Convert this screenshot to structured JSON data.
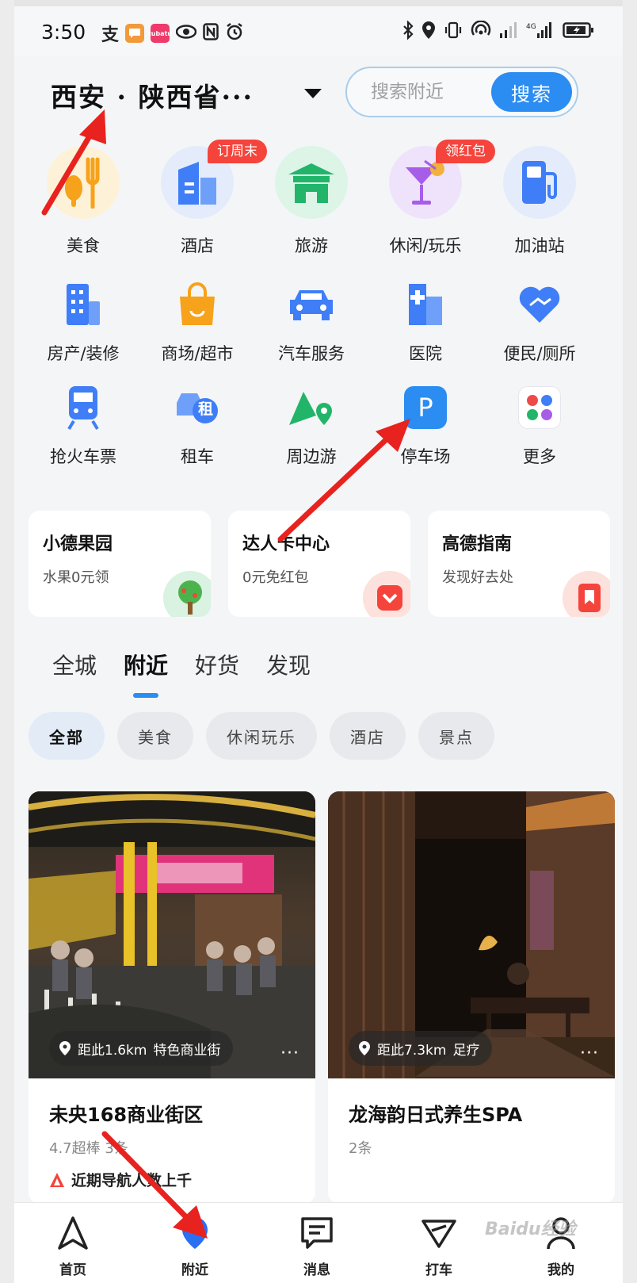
{
  "status_bar": {
    "time": "3:50",
    "left_icons": [
      "alipay-icon",
      "chat-bubble-icon",
      "app-badge-icon",
      "eye-icon",
      "nfc-icon",
      "alarm-icon"
    ],
    "app_badge_text": "tubatu",
    "right_icons": [
      "bluetooth-icon",
      "location-icon",
      "vibrate-icon",
      "hotspot-icon",
      "signal-icon",
      "4g-signal-icon",
      "battery-icon"
    ]
  },
  "header": {
    "city": "西安 · 陕西省···",
    "search_placeholder": "搜索附近",
    "search_button": "搜索"
  },
  "categories": [
    {
      "label": "美食",
      "icon": "food-icon",
      "color": "#f7a21b"
    },
    {
      "label": "酒店",
      "icon": "hotel-icon",
      "color": "#3f7ef6",
      "badge": "订周末"
    },
    {
      "label": "旅游",
      "icon": "travel-icon",
      "color": "#22b56a"
    },
    {
      "label": "休闲/玩乐",
      "icon": "cocktail-icon",
      "color": "#a65de8",
      "badge": "领红包"
    },
    {
      "label": "加油站",
      "icon": "gas-station-icon",
      "color": "#3f7ef6"
    },
    {
      "label": "房产/装修",
      "icon": "building-icon",
      "color": "#3f7ef6"
    },
    {
      "label": "商场/超市",
      "icon": "shopping-bag-icon",
      "color": "#f7a21b"
    },
    {
      "label": "汽车服务",
      "icon": "car-icon",
      "color": "#3f7ef6"
    },
    {
      "label": "医院",
      "icon": "hospital-icon",
      "color": "#3f7ef6"
    },
    {
      "label": "便民/厕所",
      "icon": "handshake-heart-icon",
      "color": "#3f7ef6"
    },
    {
      "label": "抢火车票",
      "icon": "train-icon",
      "color": "#3f7ef6"
    },
    {
      "label": "租车",
      "icon": "car-rental-icon",
      "color": "#3f7ef6",
      "icon_text": "租"
    },
    {
      "label": "周边游",
      "icon": "mountain-pin-icon",
      "color": "#22b56a"
    },
    {
      "label": "停车场",
      "icon": "parking-icon",
      "color": "#2b8cf2",
      "icon_text": "P"
    },
    {
      "label": "更多",
      "icon": "more-apps-icon",
      "color": "#ef4a4a"
    }
  ],
  "promos": [
    {
      "title": "小德果园",
      "subtitle": "水果0元领",
      "icon": "tree-icon"
    },
    {
      "title": "达人卡中心",
      "subtitle": "0元免红包",
      "icon": "red-envelope-icon"
    },
    {
      "title": "高德指南",
      "subtitle": "发现好去处",
      "icon": "bookmark-icon"
    }
  ],
  "tabs": [
    {
      "label": "全城",
      "active": false
    },
    {
      "label": "附近",
      "active": true
    },
    {
      "label": "好货",
      "active": false
    },
    {
      "label": "发现",
      "active": false
    }
  ],
  "chips": [
    {
      "label": "全部",
      "active": true
    },
    {
      "label": "美食",
      "active": false
    },
    {
      "label": "休闲玩乐",
      "active": false
    },
    {
      "label": "酒店",
      "active": false
    },
    {
      "label": "景点",
      "active": false
    }
  ],
  "feed": [
    {
      "distance": "距此1.6km",
      "category": "特色商业街",
      "title": "未央168商业街区",
      "subtitle": "4.7超棒 3条",
      "tag": "近期导航人数上千",
      "more": "···"
    },
    {
      "distance": "距此7.3km",
      "category": "足疗",
      "title": "龙海韵日式养生SPA",
      "subtitle": "2条",
      "more": "···"
    }
  ],
  "bottom_nav": [
    {
      "label": "首页",
      "icon": "navigation-arrow-icon"
    },
    {
      "label": "附近",
      "icon": "nearby-pin-icon"
    },
    {
      "label": "消息",
      "icon": "message-icon"
    },
    {
      "label": "打车",
      "icon": "taxi-icon"
    },
    {
      "label": "我的",
      "icon": "profile-icon"
    }
  ],
  "watermark": "Baidu经验",
  "colors": {
    "accent": "#2b8cf2",
    "badge_red": "#f4443c",
    "arrow_red": "#e8231f",
    "page_bg": "#f4f5f7"
  }
}
